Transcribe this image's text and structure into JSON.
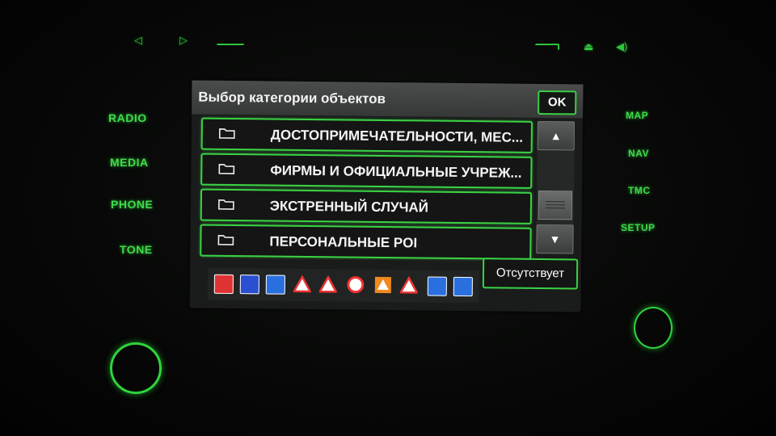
{
  "hardware": {
    "left_buttons": [
      "RADIO",
      "MEDIA",
      "PHONE",
      "TONE"
    ],
    "right_buttons": [
      "MAP",
      "NAV",
      "TMC",
      "SETUP"
    ],
    "glow_color": "#3fd94a"
  },
  "screen": {
    "title": "Выбор категории объектов",
    "ok_label": "OK",
    "categories": [
      {
        "label": "ДОСТОПРИМЕЧАТЕЛЬНОСТИ, МЕС..."
      },
      {
        "label": "ФИРМЫ И ОФИЦИАЛЬНЫЕ УЧРЕЖ..."
      },
      {
        "label": "ЭКСТРЕННЫЙ СЛУЧАЙ"
      },
      {
        "label": "ПЕРСОНАЛЬНЫЕ  POI"
      }
    ],
    "scroll_up_icon": "arrow-up-icon",
    "scroll_down_icon": "arrow-down-icon",
    "poi_icons": [
      "speed-camera-icon",
      "traffic-light-icon",
      "sign-icon",
      "warning-triangle-icon",
      "warning-triangle-icon",
      "speed-limit-icon",
      "hazard-icon",
      "warning-triangle-icon",
      "fuel-icon",
      "parking-icon"
    ],
    "absent_label": "Отсутствует",
    "accent_color": "#3bd245"
  }
}
